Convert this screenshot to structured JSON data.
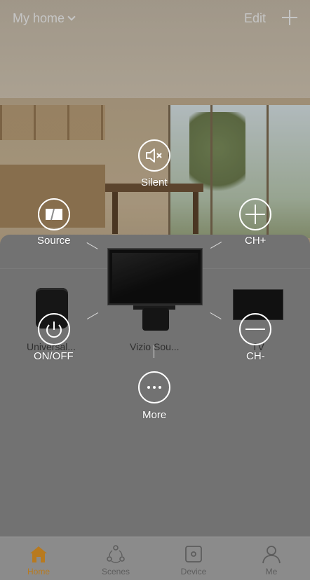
{
  "header": {
    "home_title": "My home",
    "edit_label": "Edit"
  },
  "devices": [
    {
      "label": "Universal..."
    },
    {
      "label": "Vizio Sou..."
    },
    {
      "label": "TV"
    }
  ],
  "controls": {
    "silent": "Silent",
    "source": "Source",
    "ch_plus": "CH+",
    "on_off": "ON/OFF",
    "ch_minus": "CH-",
    "more": "More"
  },
  "nav": [
    {
      "label": "Home",
      "icon": "home-icon",
      "active": true
    },
    {
      "label": "Scenes",
      "icon": "scenes-icon",
      "active": false
    },
    {
      "label": "Device",
      "icon": "device-icon",
      "active": false
    },
    {
      "label": "Me",
      "icon": "person-icon",
      "active": false
    }
  ],
  "colors": {
    "accent": "#b87a1f",
    "overlay_text": "#ffffff"
  }
}
